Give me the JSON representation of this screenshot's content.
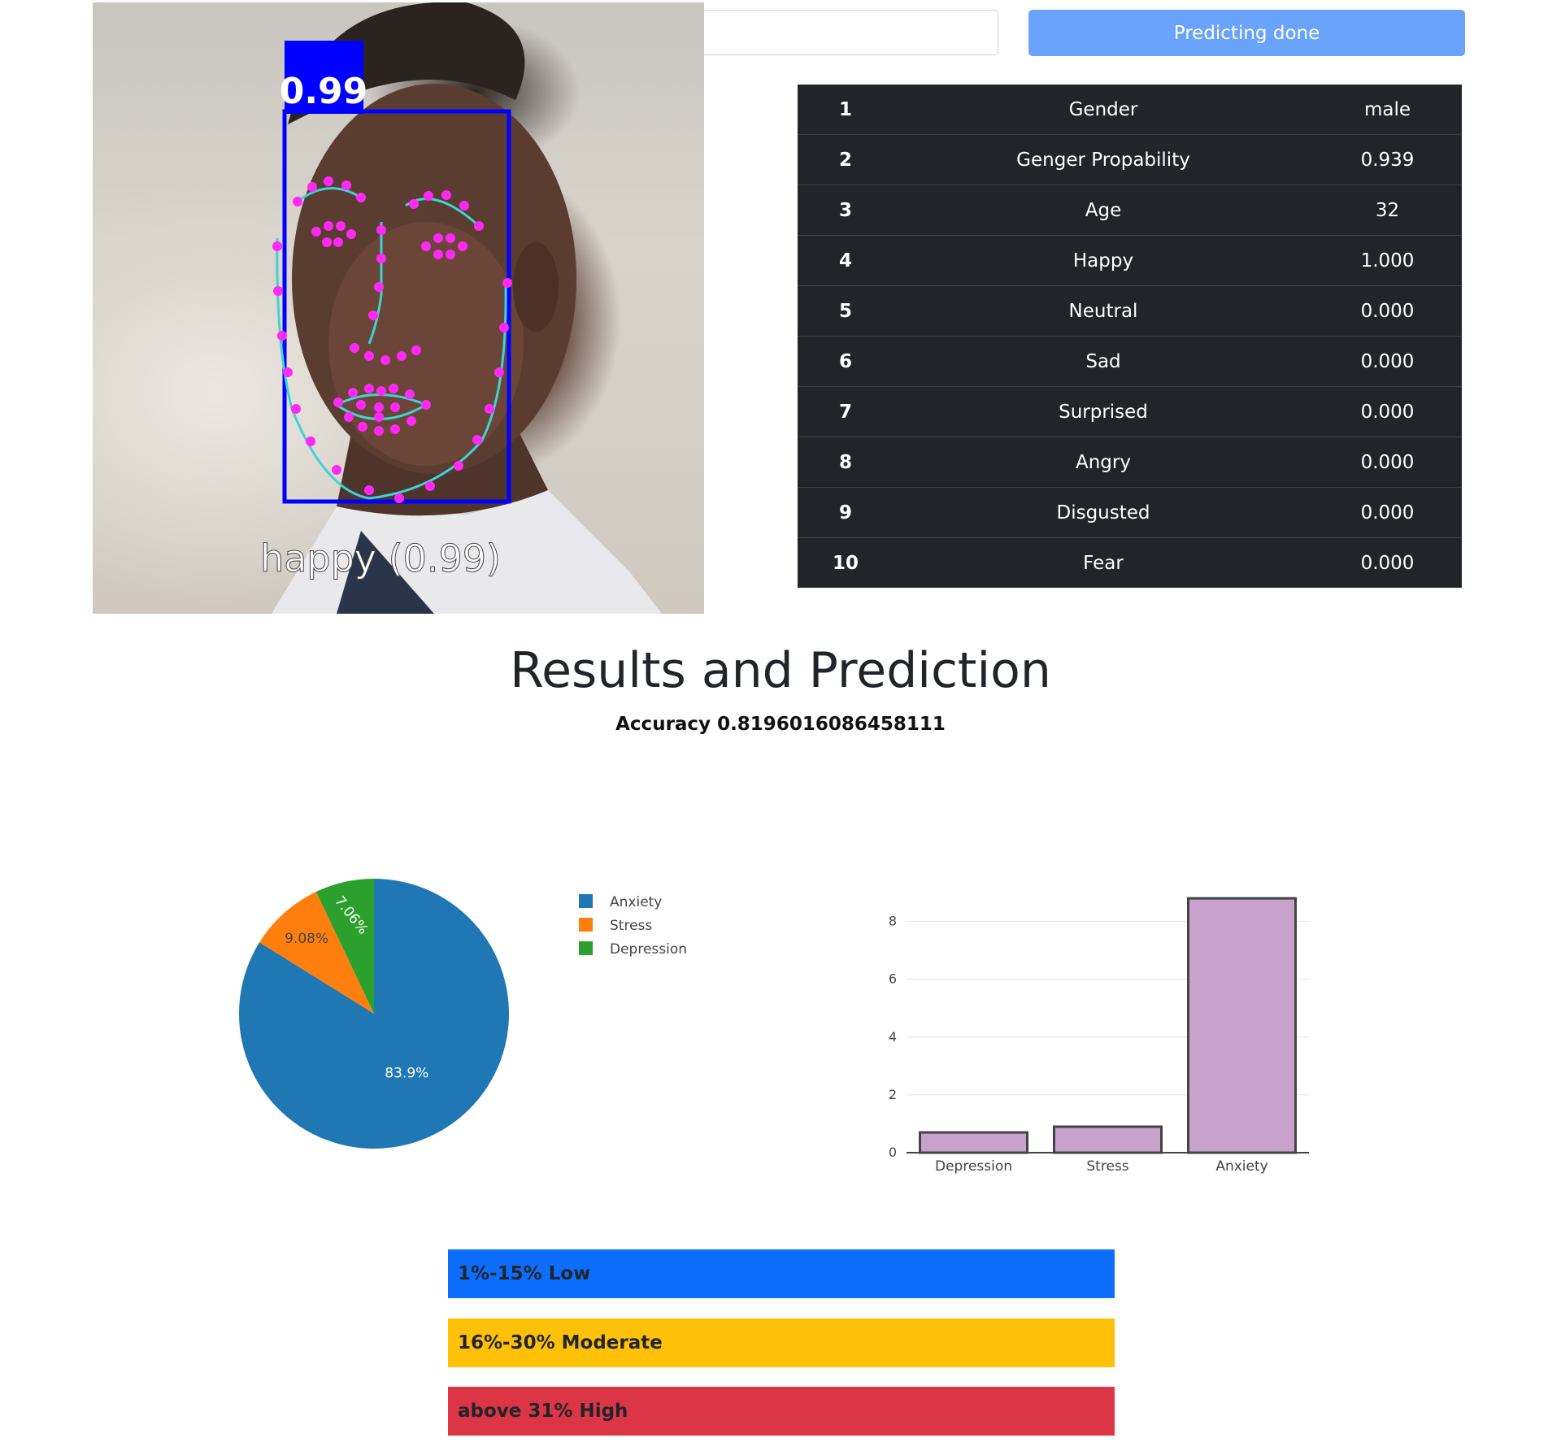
{
  "photo": {
    "face_score": "0.99",
    "emotion_caption": "happy (0.99)"
  },
  "search": {
    "value": ""
  },
  "predict_button": {
    "label": "Predicting done"
  },
  "table": {
    "rows": [
      {
        "index": "1",
        "name": "Gender",
        "value": "male"
      },
      {
        "index": "2",
        "name": "Genger Propability",
        "value": "0.939"
      },
      {
        "index": "3",
        "name": "Age",
        "value": "32"
      },
      {
        "index": "4",
        "name": "Happy",
        "value": "1.000"
      },
      {
        "index": "5",
        "name": "Neutral",
        "value": "0.000"
      },
      {
        "index": "6",
        "name": "Sad",
        "value": "0.000"
      },
      {
        "index": "7",
        "name": "Surprised",
        "value": "0.000"
      },
      {
        "index": "8",
        "name": "Angry",
        "value": "0.000"
      },
      {
        "index": "9",
        "name": "Disgusted",
        "value": "0.000"
      },
      {
        "index": "10",
        "name": "Fear",
        "value": "0.000"
      }
    ]
  },
  "results": {
    "title": "Results and Prediction",
    "accuracy": "Accuracy 0.8196016086458111"
  },
  "colors": {
    "anxiety": "#1f77b4",
    "stress": "#ff7f0e",
    "depression": "#2ca02c",
    "bar_fill": "#c8a2cc",
    "bar_stroke": "#444444",
    "level_low": "#0d6efd",
    "level_moderate": "#ffc107",
    "level_high": "#dc3545"
  },
  "chart_data": [
    {
      "type": "pie",
      "labels": [
        "Anxiety",
        "Stress",
        "Depression"
      ],
      "values": [
        83.9,
        9.08,
        7.06
      ],
      "slice_labels": [
        "83.9%",
        "9.08%",
        "7.06%"
      ],
      "legend": "right"
    },
    {
      "type": "bar",
      "categories": [
        "Depression",
        "Stress",
        "Anxiety"
      ],
      "values": [
        0.7,
        0.9,
        8.8
      ],
      "ylim": [
        0,
        9
      ],
      "yticks": [
        0,
        2,
        4,
        6,
        8
      ],
      "grid": true
    }
  ],
  "levels": [
    {
      "label": "1%-15% Low",
      "level": "low"
    },
    {
      "label": "16%-30% Moderate",
      "level": "moderate"
    },
    {
      "label": "above 31% High",
      "level": "high"
    }
  ]
}
